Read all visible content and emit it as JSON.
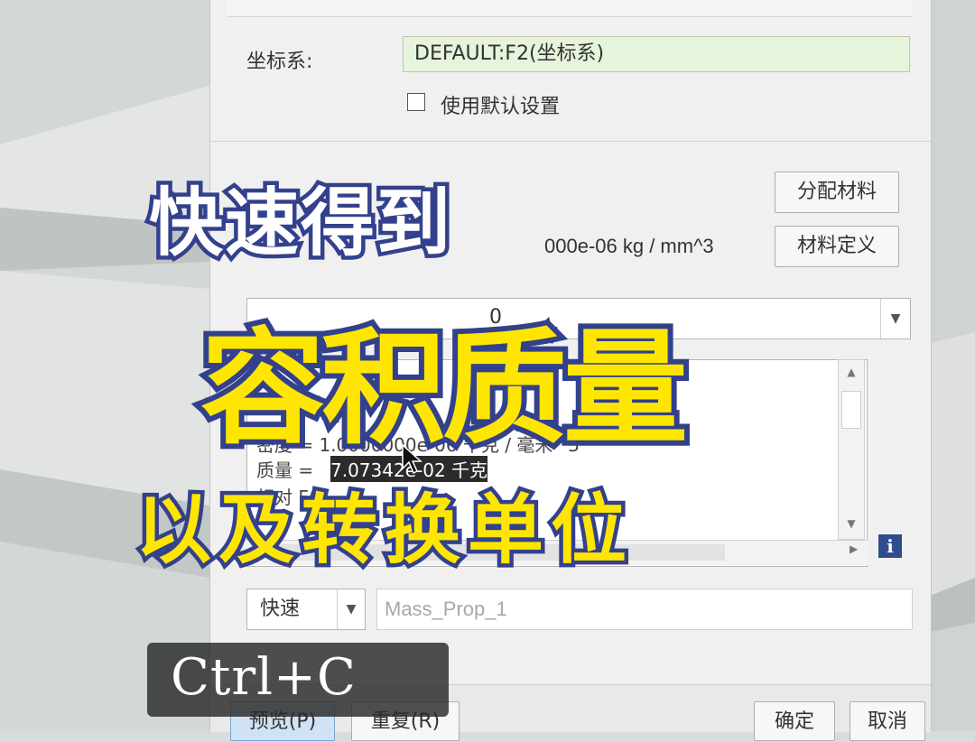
{
  "dialog": {
    "coord_label": "坐标系:",
    "coord_value": "DEFAULT:F2(坐标系)",
    "use_default_label": "使用默认设置",
    "assign_material_button": "分配材料",
    "material_define_button": "材料定义",
    "density_partial": "000e-06  kg / mm^3",
    "dropdown_partial": "0",
    "results_lines": [
      "密度 = 1.0000000e-06 千克 / 毫米^3",
      "质量 = ",
      "7.07342e-02 千克",
      "相对 FA"
    ],
    "quick_mode": "快速",
    "name_placeholder": "Mass_Prop_1",
    "preview_button": "预览(P)",
    "repeat_button": "重复(R)",
    "ok_button": "确定",
    "cancel_button": "取消"
  },
  "overlay": {
    "line1": "快速得到",
    "line2": "容积质量",
    "line3": "以及转换单位"
  },
  "keycap": {
    "text": "Ctrl+C"
  },
  "icons": {
    "info": "i",
    "dropdown_arrow": "▼",
    "scroll_up": "▲",
    "scroll_down": "▼",
    "scroll_left": "◀",
    "scroll_right": "▶"
  },
  "colors": {
    "overlay_yellow": "#ffe600",
    "overlay_outline": "#33418c",
    "coord_field_bg": "#e6f4dc",
    "info_blue": "#2f4c8c"
  }
}
